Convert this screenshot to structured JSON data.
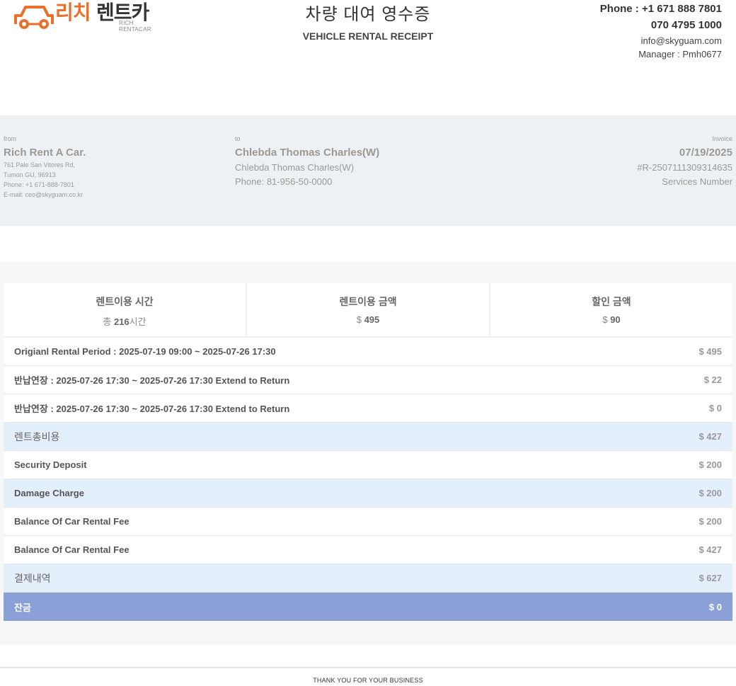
{
  "header": {
    "logo_kr_1": "리치",
    "logo_kr_2": "렌트카",
    "logo_en": "RICH RENTACAR",
    "title_kr": "차량 대여 영수증",
    "title_en": "VEHICLE RENTAL RECEIPT",
    "phone1": "Phone : +1 671 888 7801",
    "phone2": "070 4795 1000",
    "email": "info@skyguam.com",
    "manager": "Manager : Pmh0677",
    "logo_color": "#e8702a"
  },
  "from": {
    "label": "from",
    "name": "Rich Rent A Car.",
    "address1": "761 Pale San Vitores Rd,",
    "address2": "Tumon GU, 96913",
    "phone": "Phone: +1 671-888-7801",
    "email": "E-mail: ceo@skyguam.co.kr"
  },
  "to": {
    "label": "to",
    "name": "Chlebda Thomas Charles(W)",
    "line": "Chlebda Thomas Charles(W)",
    "phone": "Phone: 81-956-50-0000"
  },
  "invoice": {
    "label": "Invoice",
    "date": "07/19/2025",
    "number": "#R-2507111309314635",
    "services_label": "Services Number"
  },
  "stats": [
    {
      "title": "렌트이용 시간",
      "prefix": "총 ",
      "value": "216",
      "suffix": "시간"
    },
    {
      "title": "렌트이용 금액",
      "prefix": "$ ",
      "value": "495",
      "suffix": ""
    },
    {
      "title": "할인 금액",
      "prefix": "$ ",
      "value": "90",
      "suffix": ""
    }
  ],
  "rows": [
    {
      "label": "Origianl Rental Period : 2025-07-19 09:00 ~ 2025-07-26 17:30",
      "amount": "$ 495"
    },
    {
      "label": "반납연장 : 2025-07-26 17:30 ~ 2025-07-26 17:30 Extend to Return",
      "amount": "$ 22"
    },
    {
      "label": "반납연장 : 2025-07-26 17:30 ~ 2025-07-26 17:30 Extend to Return",
      "amount": "$ 0"
    },
    {
      "label": "렌트총비용",
      "amount": "$ 427"
    },
    {
      "label": "Security Deposit",
      "amount": "$ 200"
    },
    {
      "label": "Damage Charge",
      "amount": "$ 200"
    },
    {
      "label": "Balance Of Car Rental Fee",
      "amount": "$ 200"
    },
    {
      "label": "Balance Of Car Rental Fee",
      "amount": "$ 427"
    },
    {
      "label": "결제내역",
      "amount": "$ 627"
    },
    {
      "label": "잔금",
      "amount": "$ 0"
    }
  ],
  "footer": "THANK YOU FOR YOUR BUSINESS",
  "colors": {
    "highlight_row": "#e4effc",
    "total_row": "#8aa0d6",
    "info_band": "#eef1f3"
  }
}
